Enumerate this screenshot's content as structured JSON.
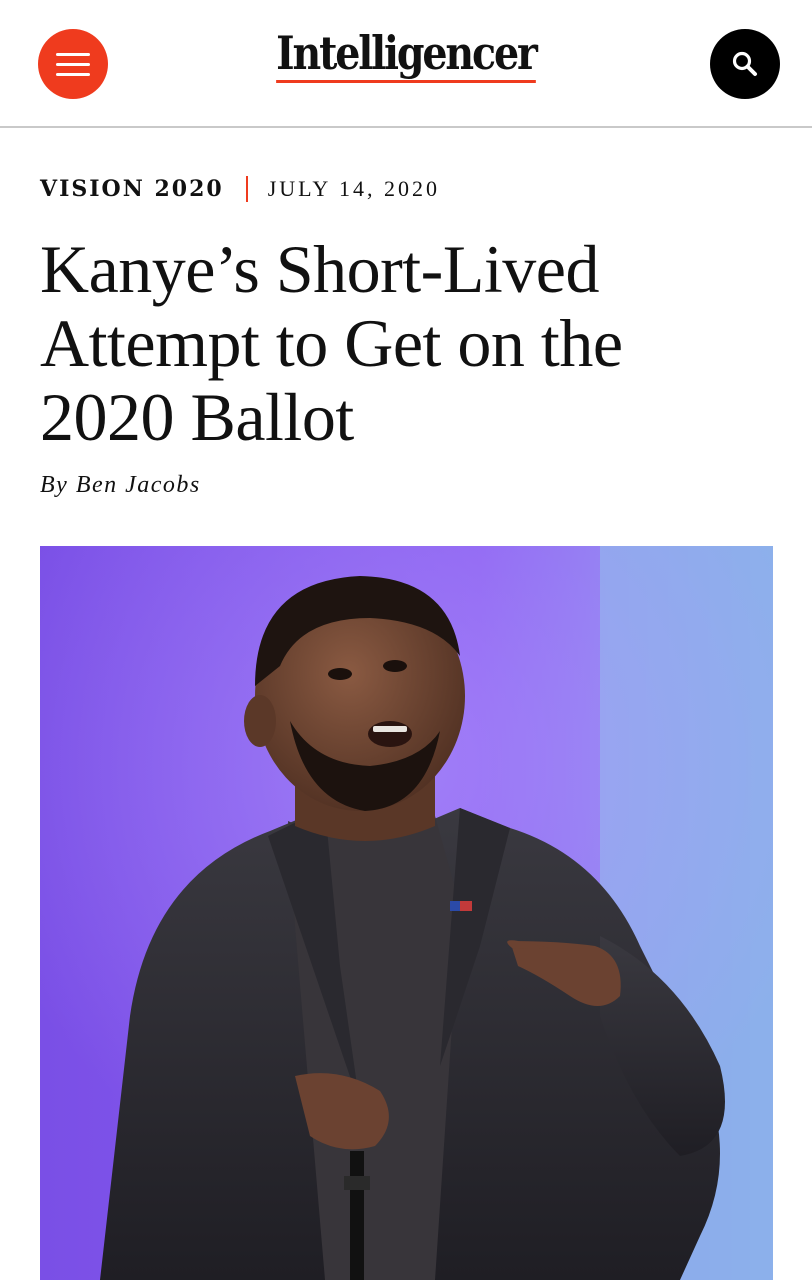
{
  "accent_color": "#ef3b1e",
  "header": {
    "menu_icon": "hamburger-menu-icon",
    "logo_text": "Intelligencer",
    "search_icon": "magnifying-glass-icon"
  },
  "article": {
    "rubric": "VISION 2020",
    "date": "JULY 14, 2020",
    "headline_lines": [
      "Kanye’s Short-Lived",
      "Attempt to Get on the",
      "2020 Ballot"
    ],
    "byline_prefix": "By",
    "author": "Ben Jacobs"
  },
  "lead_image": {
    "subject": "photo of Kanye West speaking on stage in a dark suit against a purple and blue backdrop"
  }
}
